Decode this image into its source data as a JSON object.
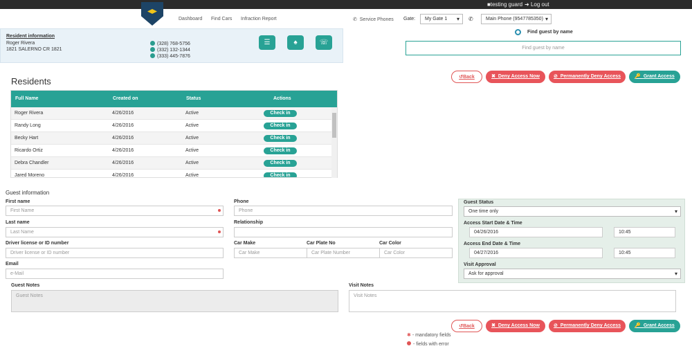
{
  "header": {
    "user": "testing guard",
    "logout": "Log out",
    "user_icon": "user-icon",
    "logout_icon": "logout-icon"
  },
  "nav": {
    "dashboard": "Dashboard",
    "find_cars": "Find Cars",
    "infraction": "Infraction Report"
  },
  "service_phones": "Service Phones",
  "gate": {
    "label": "Gate:",
    "value": "My Gate 1"
  },
  "main_phone": "Main Phone (9547785350)",
  "resident": {
    "heading": "Resident information",
    "name": "Roger Rivera",
    "address": "1821 SALERNO CR 1821",
    "phones": [
      "(328) 768-5756",
      "(332) 132-1344",
      "(333) 445-7876"
    ]
  },
  "find": {
    "heading": "Find guest by name",
    "placeholder": "Find guest by name"
  },
  "actions": {
    "back": "Back",
    "deny": "Deny Access Now",
    "perm": "Permanently Deny Access",
    "grant": "Grant Access"
  },
  "residents": {
    "title": "Residents",
    "columns": [
      "Full Name",
      "Created on",
      "Status",
      "Actions"
    ],
    "rows": [
      {
        "name": "Roger Rivera",
        "date": "4/26/2016",
        "status": "Active",
        "action": "Check in"
      },
      {
        "name": "Randy Long",
        "date": "4/26/2016",
        "status": "Active",
        "action": "Check in"
      },
      {
        "name": "Becky Hart",
        "date": "4/26/2016",
        "status": "Active",
        "action": "Check in"
      },
      {
        "name": "Ricardo Ortiz",
        "date": "4/26/2016",
        "status": "Active",
        "action": "Check in"
      },
      {
        "name": "Debra Chandler",
        "date": "4/26/2016",
        "status": "Active",
        "action": "Check in"
      },
      {
        "name": "Jared Moreno",
        "date": "4/26/2016",
        "status": "Active",
        "action": "Check in"
      }
    ]
  },
  "guest": {
    "title": "Guest information",
    "first_name": {
      "label": "First name",
      "placeholder": "First Name"
    },
    "last_name": {
      "label": "Last name",
      "placeholder": "Last Name"
    },
    "license": {
      "label": "Driver license or ID number",
      "placeholder": "Driver license or ID number"
    },
    "email": {
      "label": "Email",
      "placeholder": "e-Mail"
    },
    "phone": {
      "label": "Phone",
      "placeholder": "Phone"
    },
    "relationship": {
      "label": "Relationship",
      "placeholder": ""
    },
    "car_make": {
      "label": "Car Make",
      "placeholder": "Car Make"
    },
    "car_plate": {
      "label": "Car Plate No",
      "placeholder": "Car Plate Number"
    },
    "car_color": {
      "label": "Car Color",
      "placeholder": "Car Color"
    },
    "guest_notes": {
      "label": "Guest Notes",
      "placeholder": "Guest Notes"
    },
    "visit_notes": {
      "label": "Visit Notes",
      "placeholder": "Visit Notes"
    }
  },
  "status_panel": {
    "guest_status": {
      "label": "Guest Status",
      "value": "One time only"
    },
    "start": {
      "label": "Access Start Date & Time",
      "date": "04/26/2016",
      "time": "10:45"
    },
    "end": {
      "label": "Access End Date & Time",
      "date": "04/27/2016",
      "time": "10:45"
    },
    "approval": {
      "label": "Visit Approval",
      "value": "Ask for approval"
    }
  },
  "legend": {
    "mandatory": "- mandatory fields",
    "error": "- fields with error"
  }
}
